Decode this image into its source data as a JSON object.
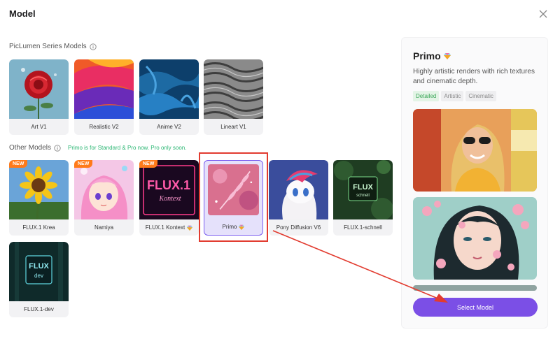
{
  "dialog": {
    "title": "Model"
  },
  "sections": {
    "series_label": "PicLumen Series Models",
    "other_label": "Other Models",
    "notice": "Primo is for Standard & Pro now. Pro only soon."
  },
  "series_models": [
    {
      "name": "Art V1"
    },
    {
      "name": "Realistic V2"
    },
    {
      "name": "Anime V2"
    },
    {
      "name": "Lineart V1"
    }
  ],
  "other_models": [
    {
      "name": "FLUX.1 Krea",
      "badge": "NEW"
    },
    {
      "name": "Namiya",
      "badge": "NEW"
    },
    {
      "name": "FLUX.1 Kontext",
      "badge": "NEW"
    },
    {
      "name": "Primo"
    },
    {
      "name": "Pony Diffusion V6"
    },
    {
      "name": "FLUX.1-schnell"
    },
    {
      "name": "FLUX.1-dev"
    }
  ],
  "thumb_text": {
    "flux_kontext_main": "FLUX.1",
    "flux_kontext_sub": "Kontext",
    "flux_schnell_main": "FLUX",
    "flux_schnell_sub": "schnell",
    "flux_dev_main": "FLUX",
    "flux_dev_sub": "dev"
  },
  "panel": {
    "title": "Primo",
    "description": "Highly artistic renders with rich textures and cinematic depth.",
    "tags": [
      "Detailed",
      "Artistic",
      "Cinematic"
    ],
    "button": "Select Model"
  },
  "colors": {
    "accent": "#7b4fe6",
    "new_badge": "#ff7a1a",
    "annotation": "#e23b2f",
    "notice": "#2bb673"
  }
}
